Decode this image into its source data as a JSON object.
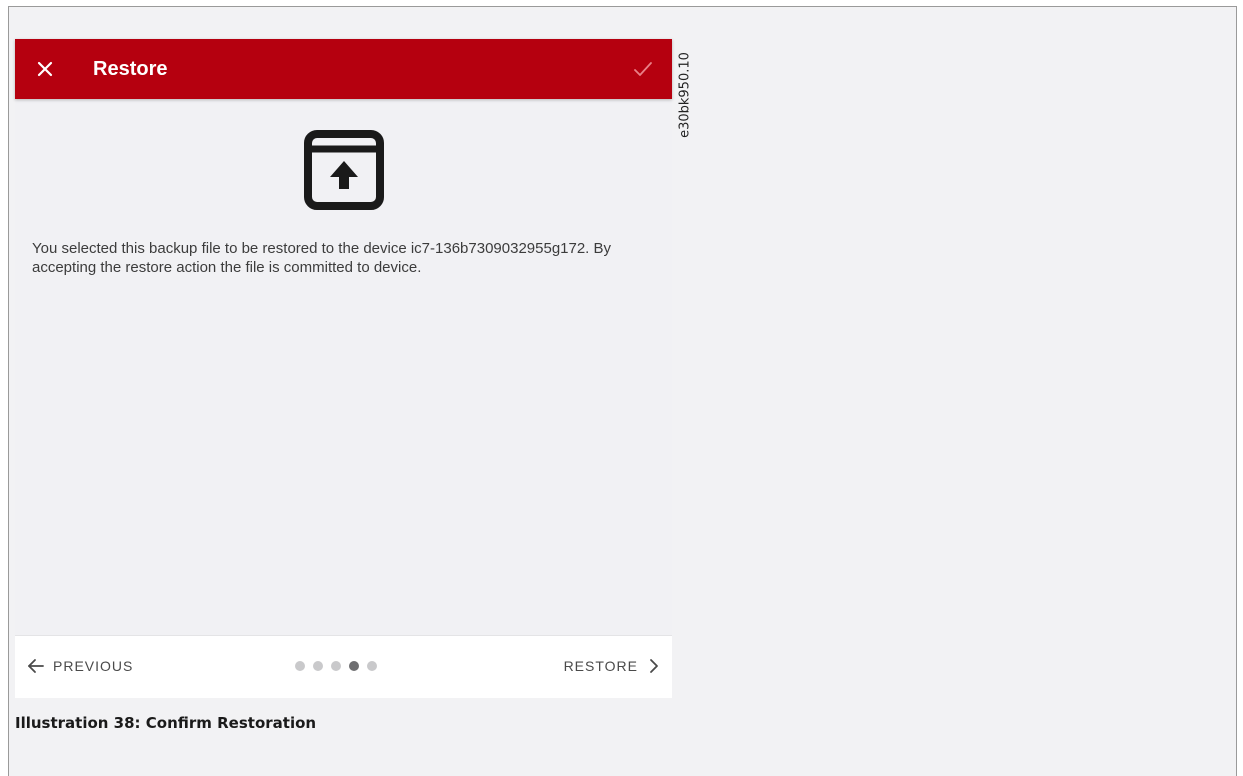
{
  "dialog": {
    "title": "Restore",
    "close_icon": "close-icon",
    "confirm_icon": "check-icon",
    "hero_icon": "archive-upload-icon",
    "message": "You selected this backup file to be restored to the device ic7-136b7309032955g172. By accepting the restore action the file is committed to device."
  },
  "navigation": {
    "previous_label": "PREVIOUS",
    "next_label": "RESTORE",
    "step_count": 5,
    "current_step": 4
  },
  "document": {
    "reference_code": "e30bk950.10",
    "caption": "Illustration 38: Confirm Restoration"
  },
  "colors": {
    "appbar": "#b5000f",
    "background": "#f1f1f4",
    "active_dot": "#6e6e70",
    "inactive_dot": "#c9c9cb"
  }
}
